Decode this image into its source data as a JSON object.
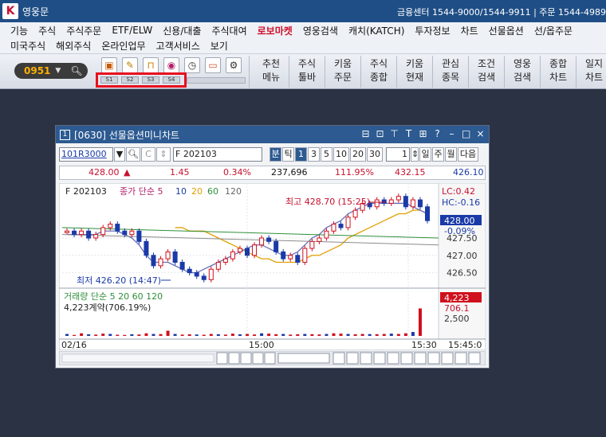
{
  "app": {
    "logo_glyph": "K",
    "title": "영웅문",
    "right_info": "금융센터 1544-9000/1544-9911 | 주문 1544-4989"
  },
  "menu": {
    "row1": [
      "기능",
      "주식",
      "주식주문",
      "ETF/ELW",
      "신용/대출",
      "주식대여",
      "로보마켓",
      "영웅검색",
      "캐치(KATCH)",
      "투자정보",
      "차트",
      "선물옵션",
      "선/옵주문"
    ],
    "highlight": "로보마켓",
    "row2": [
      "미국주식",
      "해외주식",
      "온라인업무",
      "고객서비스",
      "보기"
    ]
  },
  "toolbar": {
    "stock_code": "0951",
    "icon_names": [
      "save-icon",
      "paint-icon",
      "lock-icon",
      "camera-icon",
      "clock-icon",
      "monitor-icon",
      "gear-icon"
    ],
    "slots": [
      "S1",
      "S2",
      "S3",
      "S4"
    ],
    "big_buttons": [
      {
        "line1": "추천",
        "line2": "메뉴"
      },
      {
        "line1": "주식",
        "line2": "툴바"
      },
      {
        "line1": "키움",
        "line2": "주문"
      },
      {
        "line1": "주식",
        "line2": "종합"
      },
      {
        "line1": "키움",
        "line2": "현재"
      },
      {
        "line1": "관심",
        "line2": "종목"
      },
      {
        "line1": "조건",
        "line2": "검색"
      },
      {
        "line1": "영웅",
        "line2": "검색"
      },
      {
        "line1": "종합",
        "line2": "차트"
      },
      {
        "line1": "일지",
        "line2": "차트"
      }
    ]
  },
  "window": {
    "number": "1",
    "title": "[0630] 선물옵션미니차트",
    "code_input": "101R3000",
    "name_input": "F 202103",
    "period_buttons": [
      "분",
      "틱",
      "1",
      "3",
      "5",
      "10",
      "20",
      "30"
    ],
    "selected_period": "1",
    "count_value": "1",
    "range_buttons": [
      "일",
      "주",
      "월",
      "다음"
    ],
    "quote": {
      "price": "428.00",
      "change": "1.45",
      "change_pct": "0.34%",
      "volume": "237,696",
      "ratio": "111.95%",
      "prev": "432.15",
      "last": "426.10"
    }
  },
  "chart_data": {
    "type": "line",
    "title": "F 202103",
    "legend": [
      "종가 단순 5",
      "10",
      "20",
      "60",
      "120"
    ],
    "annotations": {
      "high": "최고 428.70 (15:25)",
      "low": "최저 426.20 (14:47)",
      "lc": "LC:0.42",
      "hc": "HC:-0.16",
      "current_label": "428.00",
      "sub_label": "-0.09%"
    },
    "y_ticks": [
      427.5,
      427.0,
      426.5
    ],
    "x_ticks": [
      "02/16",
      "15:00",
      "15:30",
      "15:45:0"
    ],
    "close": [
      427.7,
      427.6,
      427.7,
      427.5,
      427.6,
      427.8,
      427.9,
      427.7,
      427.6,
      427.7,
      427.4,
      427.0,
      426.7,
      426.9,
      427.1,
      426.8,
      426.6,
      426.5,
      426.4,
      426.3,
      426.6,
      426.8,
      426.9,
      427.1,
      427.2,
      427.0,
      427.3,
      427.5,
      427.4,
      427.1,
      426.9,
      427.0,
      426.8,
      427.2,
      427.4,
      427.5,
      427.7,
      427.9,
      427.8,
      428.1,
      428.3,
      428.5,
      428.4,
      428.6,
      428.5,
      428.6,
      428.7,
      428.4,
      428.6,
      428.4,
      428.0
    ],
    "ma5": [
      427.6,
      427.6,
      427.6,
      427.6,
      427.6,
      427.7,
      427.7,
      427.7,
      427.6,
      427.5,
      427.3,
      427.0,
      426.8,
      426.8,
      426.8,
      426.7,
      426.6,
      426.5,
      426.5,
      426.6,
      426.7,
      426.8,
      426.9,
      427.0,
      427.1,
      427.2,
      427.3,
      427.3,
      427.2,
      427.1,
      427.0,
      427.0,
      427.1,
      427.3,
      427.5,
      427.6,
      427.8,
      427.9,
      428.0,
      428.2,
      428.3,
      428.4,
      428.5,
      428.5,
      428.5,
      428.5,
      428.5,
      428.5,
      428.4,
      428.3,
      428.2
    ],
    "ma20": [
      427.8,
      427.8,
      427.7,
      427.7,
      427.7,
      427.6,
      427.5,
      427.4,
      427.3,
      427.2,
      427.1,
      427.0,
      426.9,
      426.9,
      426.8,
      426.8,
      426.8,
      426.8,
      426.9,
      427.0,
      427.0,
      427.1,
      427.2,
      427.3,
      427.5,
      427.6,
      427.7,
      427.8,
      427.9,
      428.0,
      428.1,
      428.2,
      428.2,
      428.3,
      428.3,
      428.2
    ],
    "volume_label": "거래량 단순 5 20 60 120",
    "volume_summary": "4,223계약(706.19%)",
    "volume_last": "4,223",
    "volume_ratio_label": "706.1",
    "volume_tick": "2,500",
    "volume": [
      300,
      150,
      400,
      250,
      200,
      350,
      300,
      180,
      150,
      260,
      220,
      400,
      300,
      280,
      800,
      300,
      200,
      250,
      220,
      180,
      300,
      260,
      200,
      350,
      250,
      300,
      220,
      400,
      350,
      260,
      300,
      200,
      250,
      300,
      260,
      220,
      300,
      400,
      350,
      300,
      250,
      300,
      280,
      260,
      300,
      350,
      300,
      400,
      600,
      4223
    ],
    "colors": {
      "up": "#d0101e",
      "down": "#1a3aa8",
      "ma5": "#6a6fb8",
      "ma10": "#c0389a",
      "ma20": "#e0a000",
      "ma60": "#2e8f3a",
      "ma120": "#8b8b8b"
    }
  }
}
